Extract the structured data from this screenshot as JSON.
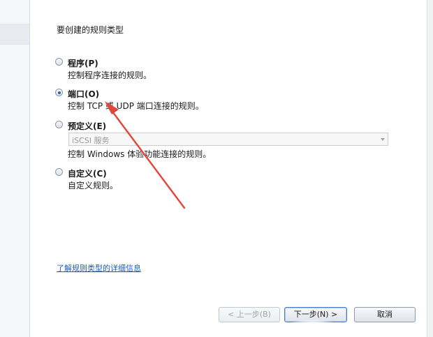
{
  "wizard": {
    "heading": "要创建的规则类型",
    "options": [
      {
        "label": "程序(P)",
        "description": "控制程序连接的规则。",
        "checked": false
      },
      {
        "label": "端口(O)",
        "description": "控制 TCP 或 UDP 端口连接的规则。",
        "checked": true
      },
      {
        "label": "预定义(E)",
        "description": "控制 Windows 体验功能连接的规则。",
        "checked": false
      },
      {
        "label": "自定义(C)",
        "description": "自定义规则。",
        "checked": false
      }
    ],
    "predefined_select": {
      "value": "iSCSI 服务"
    },
    "learn_more_link": "了解规则类型的详细信息",
    "buttons": {
      "back": "< 上一步(B)",
      "next": "下一步(N) >",
      "cancel": "取消"
    }
  },
  "colors": {
    "annotation_arrow": "#e0463a",
    "link": "#1d5cbf",
    "radio_dot": "#2b5fa8"
  }
}
